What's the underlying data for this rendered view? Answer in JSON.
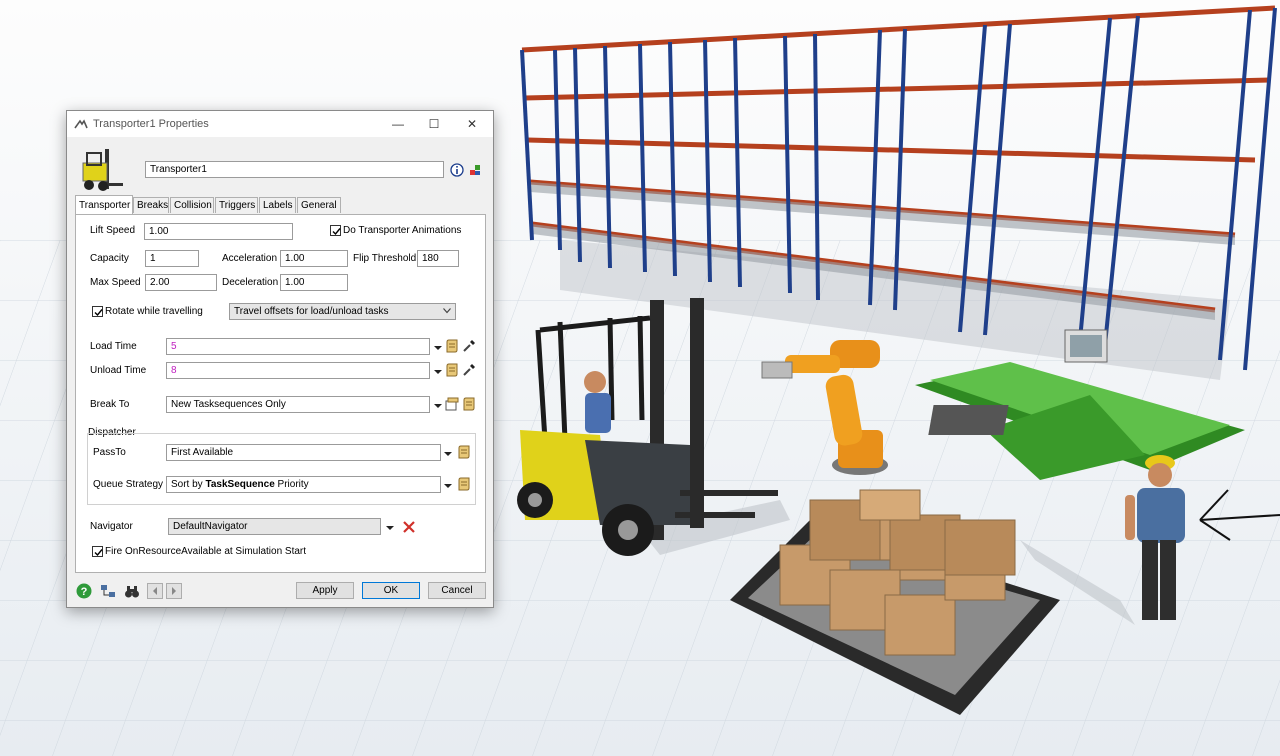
{
  "window": {
    "title": "Transporter1  Properties",
    "minimize": "—",
    "maximize": "☐",
    "close": "✕"
  },
  "header": {
    "name_value": "Transporter1"
  },
  "tabs": [
    "Transporter",
    "Breaks",
    "Collision",
    "Triggers",
    "Labels",
    "General"
  ],
  "form": {
    "lift_speed_label": "Lift Speed",
    "lift_speed_value": "1.00",
    "do_anim_label": "Do Transporter Animations",
    "capacity_label": "Capacity",
    "capacity_value": "1",
    "acceleration_label": "Acceleration",
    "acceleration_value": "1.00",
    "flip_threshold_label": "Flip Threshold",
    "flip_threshold_value": "180",
    "max_speed_label": "Max Speed",
    "max_speed_value": "2.00",
    "deceleration_label": "Deceleration",
    "deceleration_value": "1.00",
    "rotate_label": "Rotate while travelling",
    "travel_offsets_value": "Travel offsets for load/unload tasks",
    "load_time_label": "Load Time",
    "load_time_value": "5",
    "unload_time_label": "Unload Time",
    "unload_time_value": "8",
    "break_to_label": "Break To",
    "break_to_value": "New Tasksequences Only",
    "dispatcher_label": "Dispatcher",
    "pass_to_label": "PassTo",
    "pass_to_value": "First Available",
    "queue_strategy_label": "Queue Strategy",
    "queue_strategy_prefix": "Sort by ",
    "queue_strategy_bold": "TaskSequence",
    "queue_strategy_suffix": " Priority",
    "navigator_label": "Navigator",
    "navigator_value": "DefaultNavigator",
    "fire_label": "Fire OnResourceAvailable at Simulation Start"
  },
  "buttons": {
    "apply": "Apply",
    "ok": "OK",
    "cancel": "Cancel"
  },
  "colors": {
    "rack_blue": "#1f3f8a",
    "rack_orange": "#b5401e",
    "robot_orange": "#e8901a",
    "conveyor_green": "#3a9a2a",
    "forklift_yellow": "#e0d21a"
  }
}
